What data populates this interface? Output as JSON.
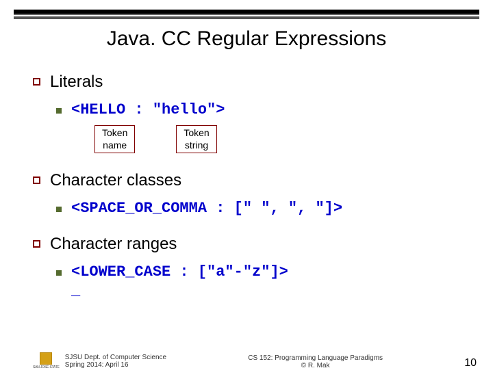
{
  "title": "Java. CC Regular Expressions",
  "sections": [
    {
      "heading": "Literals",
      "code": "<HELLO : \"hello\">",
      "annotations": [
        "Token\nname",
        "Token\nstring"
      ]
    },
    {
      "heading": "Character classes",
      "code": "<SPACE_OR_COMMA : [\" \", \", \"]>"
    },
    {
      "heading": "Character ranges",
      "code": "<LOWER_CASE : [\"a\"-\"z\"]>",
      "underscore": "_"
    }
  ],
  "footer": {
    "left_line1": "SJSU Dept. of Computer Science",
    "left_line2": "Spring 2014: April 16",
    "mid_line1": "CS 152: Programming Language Paradigms",
    "mid_line2": "© R. Mak",
    "page": "10",
    "logo_text": "SAN JOSÉ STATE"
  }
}
